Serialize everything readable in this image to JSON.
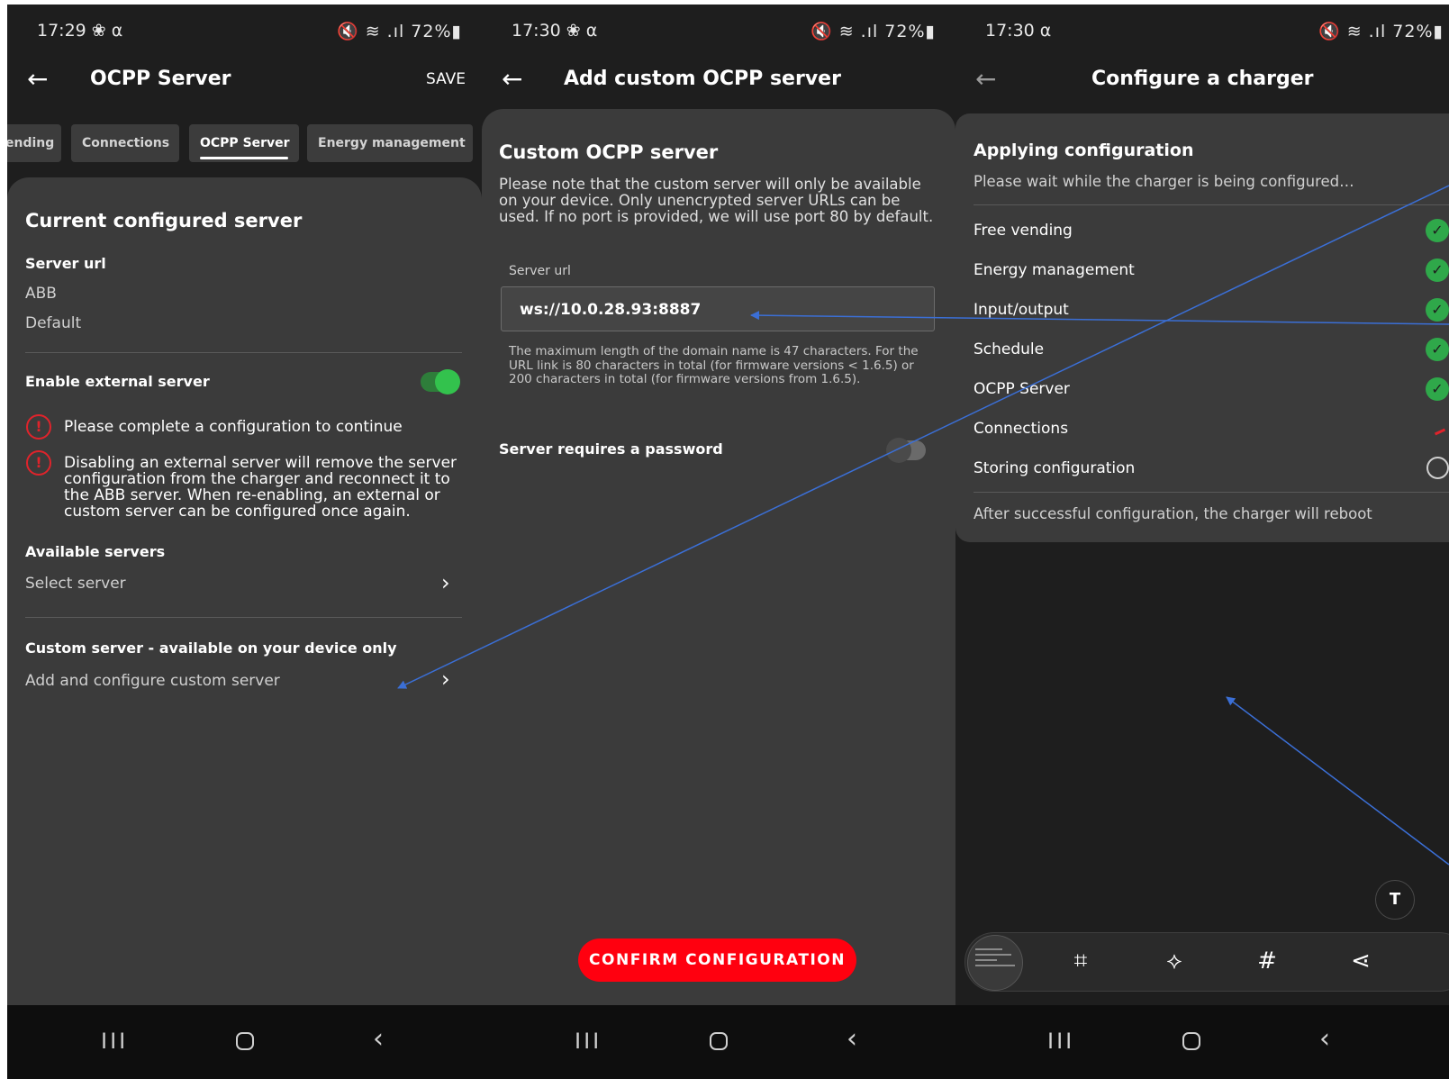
{
  "screen1": {
    "status": {
      "time": "17:29 ❀ ⍺",
      "icons": "🔇 ≋ .ıl 72%▮"
    },
    "appbar": {
      "title": "OCPP Server",
      "save": "SAVE"
    },
    "tabs": [
      "ending",
      "Connections",
      "OCPP Server",
      "Energy management"
    ],
    "current_heading": "Current configured server",
    "server_url_label": "Server url",
    "server_url_value": "ABB",
    "server_url_sub": "Default",
    "enable_external_label": "Enable external server",
    "enable_external_on": true,
    "warnings": [
      "Please complete a configuration to continue",
      "Disabling an external server will remove the server configuration from the charger and reconnect it to the ABB server. When re-enabling, an external or custom server can be configured once again."
    ],
    "available_label": "Available servers",
    "select_server": "Select server",
    "custom_label": "Custom server - available on your device only",
    "add_custom": "Add and configure custom server"
  },
  "screen2": {
    "status": {
      "time": "17:30 ❀ ⍺",
      "icons": "🔇 ≋ .ıl 72%▮"
    },
    "appbar": {
      "title": "Add custom OCPP server"
    },
    "heading": "Custom OCPP server",
    "note": "Please note that the custom server will only be available on your device. Only unencrypted server URLs can be used. If no port is provided, we will use port 80 by default.",
    "field_label": "Server url",
    "field_value": "ws://10.0.28.93:8887",
    "hint": "The maximum length of the domain name is 47 characters. For the URL link is 80 characters in total (for firmware versions < 1.6.5) or 200 characters in total (for firmware versions from 1.6.5).",
    "password_label": "Server requires a password",
    "password_on": false,
    "confirm": "CONFIRM CONFIGURATION"
  },
  "screen3": {
    "status": {
      "time": "17:30 ⍺",
      "icons": "🔇 ≋ .ıl 72%▮"
    },
    "appbar": {
      "title": "Configure a charger"
    },
    "heading": "Applying configuration",
    "wait": "Please wait while the charger is being configured…",
    "steps": [
      {
        "label": "Free vending",
        "state": "done"
      },
      {
        "label": "Energy management",
        "state": "done"
      },
      {
        "label": "Input/output",
        "state": "done"
      },
      {
        "label": "Schedule",
        "state": "done"
      },
      {
        "label": "OCPP Server",
        "state": "done"
      },
      {
        "label": "Connections",
        "state": "in-progress"
      },
      {
        "label": "Storing configuration",
        "state": "pending"
      }
    ],
    "footer": "After successful configuration, the charger will reboot",
    "text_fab": "T",
    "tools": [
      "scan-icon",
      "crop-edit-icon",
      "hashtag-icon",
      "share-icon"
    ],
    "tool_glyphs": [
      "⌗",
      "⟡",
      "#",
      "⋖"
    ]
  },
  "nav_glyphs": {
    "recents": "III",
    "back": "‹"
  },
  "colors": {
    "accent_red": "#ff000f",
    "toggle_green": "#33c24d",
    "check_green": "#2fa84a",
    "warning_red": "#e0232b",
    "sheet": "#3b3b3b",
    "background": "#1e1e1e",
    "annotation_arrow": "#3b6fd6"
  }
}
